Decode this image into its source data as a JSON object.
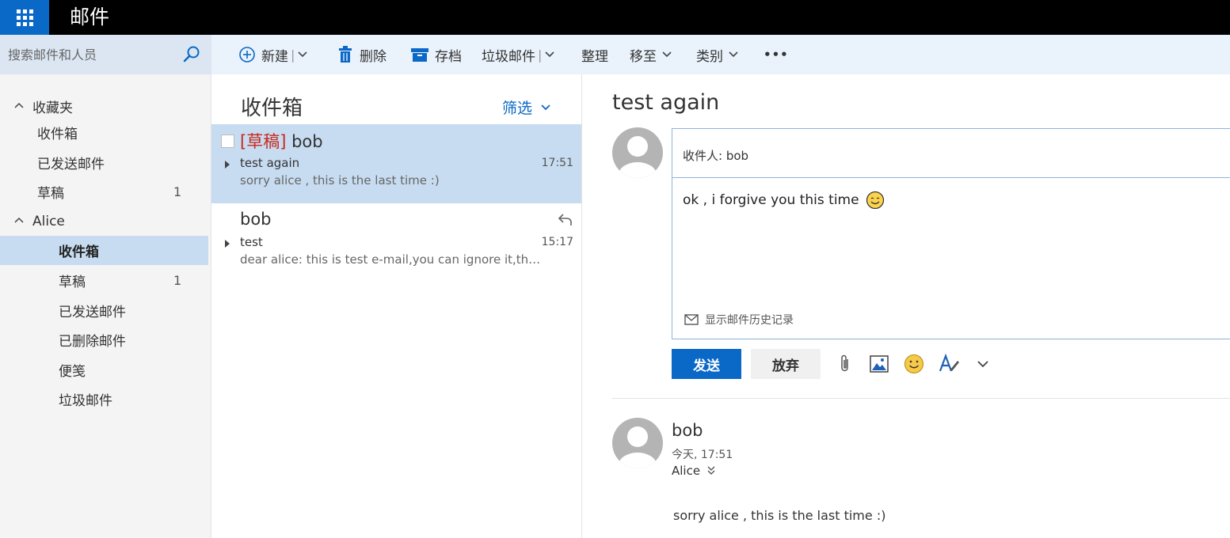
{
  "app": {
    "title": "邮件"
  },
  "search": {
    "placeholder": "搜索邮件和人员"
  },
  "toolbar": {
    "new_label": "新建",
    "delete_label": "删除",
    "archive_label": "存档",
    "junk_label": "垃圾邮件",
    "sweep_label": "整理",
    "move_label": "移至",
    "categorize_label": "类别",
    "more_label": "•••",
    "separator": "|"
  },
  "folders": {
    "favorites": {
      "label": "收藏夹",
      "items": [
        {
          "label": "收件箱",
          "count": ""
        },
        {
          "label": "已发送邮件",
          "count": ""
        },
        {
          "label": "草稿",
          "count": "1"
        }
      ]
    },
    "account": {
      "label": "Alice",
      "items": [
        {
          "label": "收件箱",
          "count": ""
        },
        {
          "label": "草稿",
          "count": "1"
        },
        {
          "label": "已发送邮件",
          "count": ""
        },
        {
          "label": "已删除邮件",
          "count": ""
        },
        {
          "label": "便笺",
          "count": ""
        },
        {
          "label": "垃圾邮件",
          "count": ""
        }
      ]
    }
  },
  "list": {
    "title": "收件箱",
    "filter_label": "筛选",
    "messages": [
      {
        "draft_tag": "[草稿]",
        "sender": "bob",
        "subject": "test again",
        "time": "17:51",
        "preview": "sorry alice , this is the last time :)"
      },
      {
        "draft_tag": "",
        "sender": "bob",
        "subject": "test",
        "time": "15:17",
        "preview": "dear alice: this is test e-mail,you can ignore it,thinks!"
      }
    ]
  },
  "reading": {
    "subject": "test again",
    "compose": {
      "to_label": "收件人:",
      "to_value": "bob",
      "body": "ok , i forgive you this time",
      "history_label": "显示邮件历史记录",
      "send_label": "发送",
      "discard_label": "放弃"
    },
    "message": {
      "sender": "bob",
      "datetime": "今天, 17:51",
      "recipient": "Alice",
      "body": "sorry alice , this is the last time :)"
    }
  },
  "colors": {
    "accent": "#0a68c7",
    "selected": "#c7dcf1",
    "draft": "#c8281b"
  }
}
